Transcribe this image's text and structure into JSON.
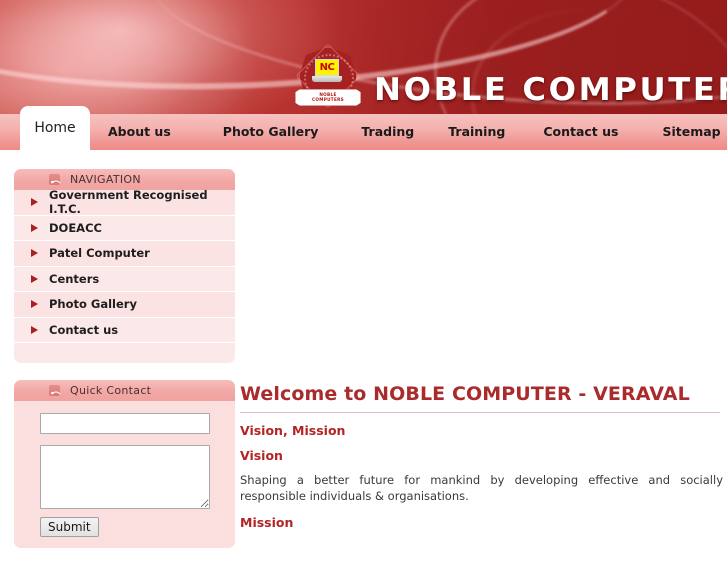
{
  "header": {
    "brand_title": "NOBLE COMPUTERS",
    "logo": {
      "monogram": "NC",
      "ribbon_line1": "NOBLE",
      "ribbon_line2": "COMPUTERS"
    },
    "colors": {
      "banner_red": "#a62222",
      "banner_light_red": "#cf5a51",
      "navbar_pink": "#f4b0ae",
      "accent_dark_red": "#a92b2b"
    }
  },
  "nav": {
    "items": [
      {
        "label": "Home",
        "active": true
      },
      {
        "label": "About us",
        "active": false
      },
      {
        "label": "Photo Gallery",
        "active": false
      },
      {
        "label": "Trading",
        "active": false
      },
      {
        "label": "Training",
        "active": false
      },
      {
        "label": "Contact us",
        "active": false
      },
      {
        "label": "Sitemap",
        "active": false
      }
    ]
  },
  "sidebar": {
    "navigation_panel": {
      "title": "NAVIGATION",
      "icon": "rss-feed-icon",
      "items": [
        {
          "label": "Government Recognised I.T.C."
        },
        {
          "label": "DOEACC"
        },
        {
          "label": "Patel Computer"
        },
        {
          "label": "Centers"
        },
        {
          "label": "Photo Gallery"
        },
        {
          "label": "Contact us"
        }
      ]
    },
    "quick_contact_panel": {
      "title": "Quick Contact",
      "icon": "rss-feed-icon",
      "name_value": "",
      "name_placeholder": "",
      "message_value": "",
      "message_placeholder": "",
      "submit_label": "Submit"
    }
  },
  "main": {
    "title": "Welcome to NOBLE COMPUTER - VERAVAL",
    "section_label": "Vision, Mission",
    "vision_heading": "Vision",
    "vision_text": "Shaping a better future for mankind by developing effective and socially responsible individuals & organisations.",
    "mission_heading": "Mission"
  }
}
